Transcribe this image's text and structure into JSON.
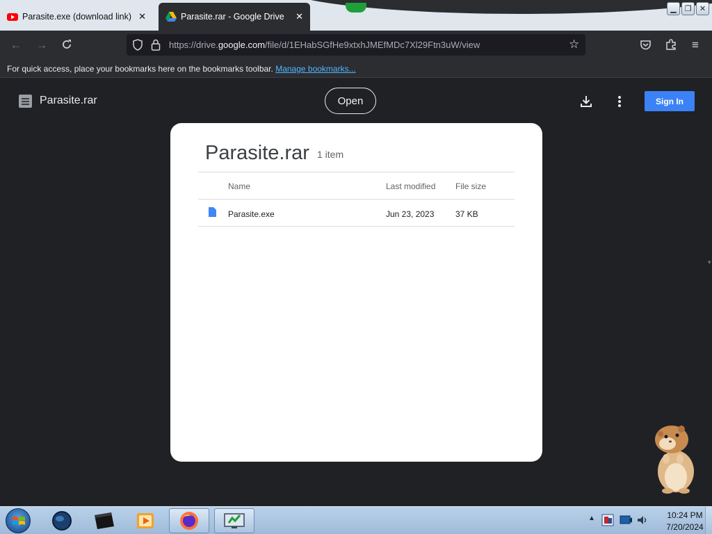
{
  "browser": {
    "tabs": [
      {
        "title": "Parasite.exe (download link) - Y",
        "favicon": "youtube-icon",
        "active": false
      },
      {
        "title": "Parasite.rar - Google Drive",
        "favicon": "google-drive-icon",
        "active": true
      }
    ],
    "url": {
      "prefix": "https://drive.",
      "domain": "google.com",
      "path": "/file/d/1EHabSGfHe9xtxhJMEfMDc7Xl29Ftn3uW/view"
    },
    "bookmarks_bar": {
      "message": "For quick access, place your bookmarks here on the bookmarks toolbar.",
      "link": "Manage bookmarks..."
    }
  },
  "drive": {
    "header_title": "Parasite.rar",
    "open_label": "Open",
    "signin_label": "Sign In",
    "archive": {
      "title": "Parasite.rar",
      "item_count": "1 item",
      "columns": {
        "name": "Name",
        "modified": "Last modified",
        "size": "File size"
      },
      "files": [
        {
          "name": "Parasite.exe",
          "modified": "Jun 23, 2023",
          "size": "37 KB"
        }
      ]
    }
  },
  "taskbar": {
    "clock_time": "10:24 PM",
    "clock_date": "7/20/2024"
  },
  "colors": {
    "page_bg": "#202124",
    "accent_blue": "#3b82f6",
    "link_blue": "#50b7ff"
  }
}
